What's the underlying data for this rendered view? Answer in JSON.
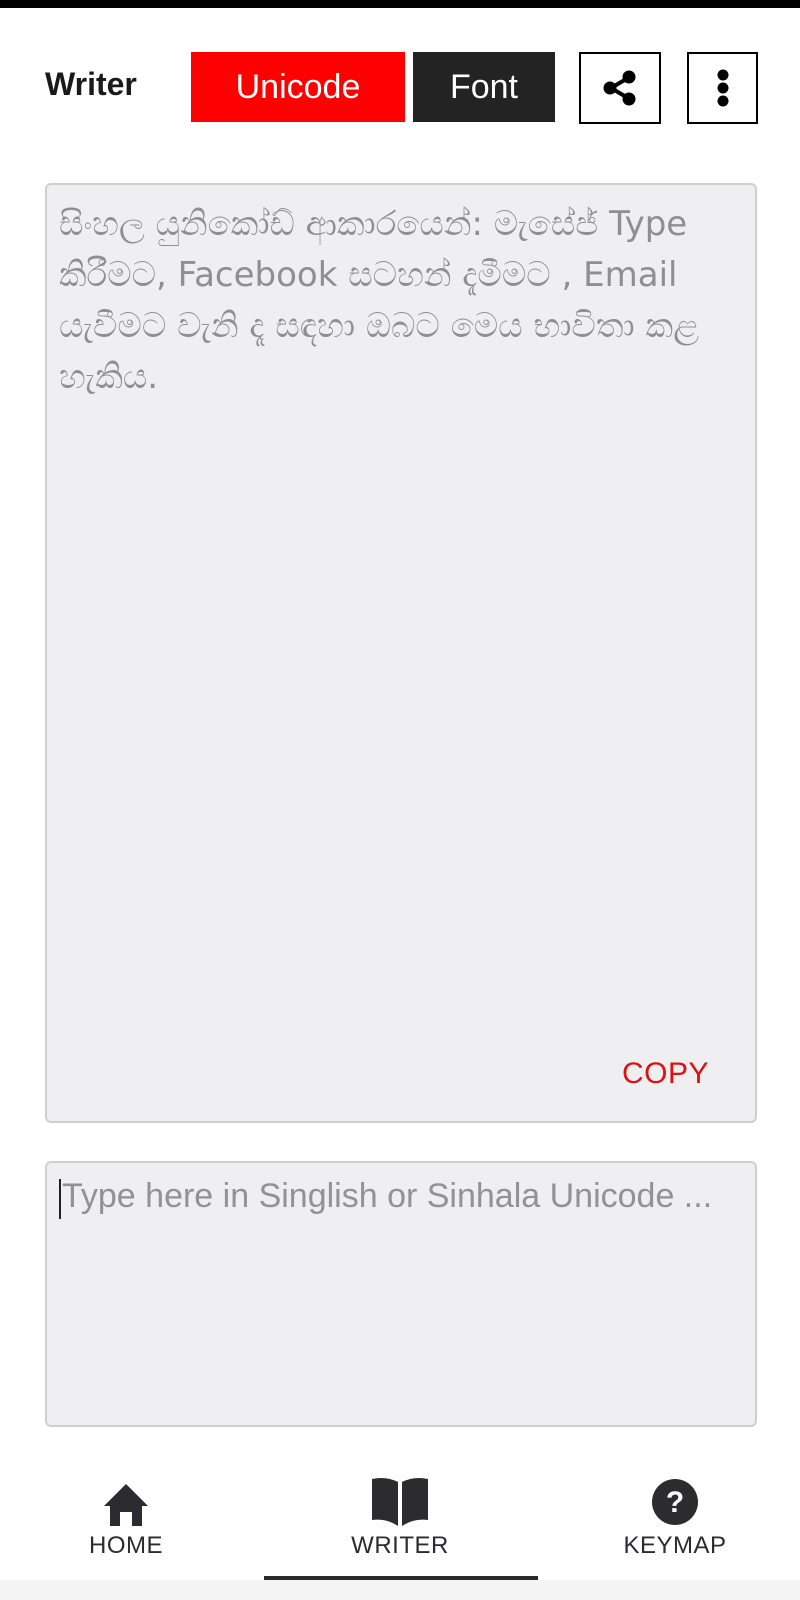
{
  "header": {
    "title": "Writer",
    "unicode_label": "Unicode",
    "font_label": "Font",
    "share_icon": "share-icon",
    "more_icon": "more-vertical-icon"
  },
  "colors": {
    "accent": "#ff0000",
    "dark": "#232323",
    "copy": "#dd1111",
    "box_bg": "#efeff2"
  },
  "output": {
    "placeholder": "සිංහල යුනිකෝඩ් ආකාරයෙන්: මැසේජ් Type කිරීමට, Facebook සටහන් දැමීමට , Email යැවීමට වැනි දෑ සඳහා ඔබට මෙය භාවිතා කළ හැකිය.",
    "copy_label": "COPY"
  },
  "input": {
    "value": "",
    "placeholder": "Type here in Singlish or Sinhala Unicode ..."
  },
  "bottom_nav": {
    "items": [
      {
        "label": "HOME",
        "icon": "home-icon"
      },
      {
        "label": "WRITER",
        "icon": "book-icon",
        "active": true
      },
      {
        "label": "KEYMAP",
        "icon": "help-circle-icon"
      }
    ]
  }
}
